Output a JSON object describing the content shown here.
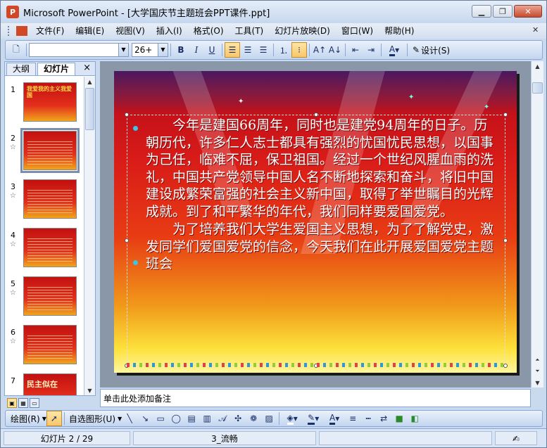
{
  "window": {
    "title": "Microsoft PowerPoint - [大学国庆节主题班会PPT课件.ppt]",
    "app_icon": "P",
    "controls": [
      "minimize-icon",
      "restore-icon",
      "close-icon"
    ]
  },
  "menubar": {
    "items": [
      "文件(F)",
      "编辑(E)",
      "视图(V)",
      "插入(I)",
      "格式(O)",
      "工具(T)",
      "幻灯片放映(D)",
      "窗口(W)",
      "帮助(H)"
    ]
  },
  "toolbar": {
    "font_name": "",
    "font_size": "26+",
    "bold": "B",
    "italic": "I",
    "underline": "U",
    "design_label": "设计(S)"
  },
  "left_panel": {
    "tabs": [
      "大纲",
      "幻灯片"
    ],
    "active_tab": "幻灯片",
    "close": "×",
    "thumbs": [
      {
        "num": "1",
        "title": "我爱我的主义我爱国"
      },
      {
        "num": "2",
        "title": ""
      },
      {
        "num": "3",
        "title": ""
      },
      {
        "num": "4",
        "title": ""
      },
      {
        "num": "5",
        "title": ""
      },
      {
        "num": "6",
        "title": ""
      },
      {
        "num": "7",
        "title": "民主似在"
      }
    ],
    "selected_index": 2
  },
  "slide": {
    "paragraphs": [
      "今年是建国66周年，同时也是建党94周年的日子。历朝历代，许多仁人志士都具有强烈的忧国忧民思想，以国事为己任，临难不屈，保卫祖国。经过一个世纪风腥血雨的洗礼，中国共产党领导中国人名不断地探索和奋斗，将旧中国建设成繁荣富强的社会主义新中国，取得了举世瞩目的光辉成就。到了和平繁华的年代，我们同样要爱国爱党。",
      "为了培养我们大学生爱国主义思想，为了了解党史，激发同学们爱国爱党的信念，今天我们在此开展爱国爱党主题班会"
    ]
  },
  "notes": {
    "placeholder": "单击此处添加备注"
  },
  "drawbar": {
    "draw_label": "绘图(R)",
    "autoshapes_label": "自选图形(U)"
  },
  "status": {
    "slide_info": "幻灯片 2 / 29",
    "template": "3_流畅",
    "language_icon": "spellcheck-icon"
  },
  "colors": {
    "accent": "#d24726",
    "chrome": "#c9d9ee",
    "slide_red": "#d91c18",
    "slide_yellow": "#fde13b"
  }
}
